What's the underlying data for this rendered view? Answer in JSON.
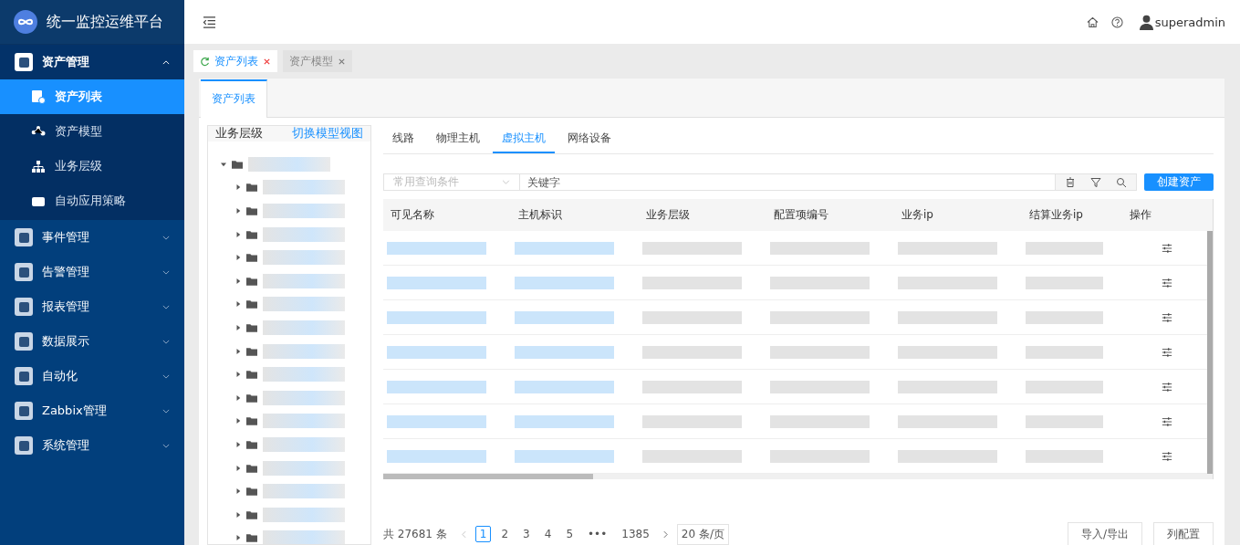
{
  "app": {
    "title": "统一监控运维平台"
  },
  "header": {
    "user": "superadmin"
  },
  "menu": [
    {
      "label": "资产管理",
      "expanded": true,
      "children": [
        {
          "label": "资产列表",
          "selected": true
        },
        {
          "label": "资产模型",
          "selected": false
        },
        {
          "label": "业务层级",
          "selected": false
        },
        {
          "label": "自动应用策略",
          "selected": false
        }
      ]
    },
    {
      "label": "事件管理",
      "expanded": false
    },
    {
      "label": "告警管理",
      "expanded": false
    },
    {
      "label": "报表管理",
      "expanded": false
    },
    {
      "label": "数据展示",
      "expanded": false
    },
    {
      "label": "自动化",
      "expanded": false
    },
    {
      "label": "Zabbix管理",
      "expanded": false
    },
    {
      "label": "系统管理",
      "expanded": false
    }
  ],
  "page_tabs": [
    {
      "label": "资产列表",
      "selected": true
    },
    {
      "label": "资产模型",
      "selected": false
    }
  ],
  "inner_tabs": [
    {
      "label": "资产列表",
      "selected": true
    }
  ],
  "tree_panel": {
    "title": "业务层级",
    "link": "切换模型视图",
    "root": {
      "expanded": true,
      "children": [
        {
          "expanded": false
        },
        {
          "expanded": false
        },
        {
          "expanded": false
        },
        {
          "expanded": false
        },
        {
          "expanded": false
        },
        {
          "expanded": false
        },
        {
          "expanded": false
        },
        {
          "expanded": false
        },
        {
          "expanded": false
        },
        {
          "expanded": false
        },
        {
          "expanded": false
        },
        {
          "expanded": false
        },
        {
          "expanded": false
        },
        {
          "expanded": false
        },
        {
          "expanded": false
        },
        {
          "expanded": false
        }
      ]
    }
  },
  "category_tabs": [
    {
      "label": "线路",
      "selected": false
    },
    {
      "label": "物理主机",
      "selected": false
    },
    {
      "label": "虚拟主机",
      "selected": true
    },
    {
      "label": "网络设备",
      "selected": false
    }
  ],
  "search": {
    "condition_placeholder": "常用查询条件",
    "placeholder": "关键字",
    "create_button": "创建资产"
  },
  "table": {
    "columns": [
      "可见名称",
      "主机标识",
      "业务层级",
      "配置项编号",
      "业务ip",
      "结算业务ip",
      "操作"
    ],
    "rows": [
      {
        "redacted": true
      },
      {
        "redacted": true
      },
      {
        "redacted": true
      },
      {
        "redacted": true
      },
      {
        "redacted": true
      },
      {
        "redacted": true
      },
      {
        "redacted": true
      }
    ]
  },
  "pagination": {
    "total": "共 27681 条",
    "pages": [
      {
        "label": "1",
        "selected": true
      },
      {
        "label": "2",
        "selected": false
      },
      {
        "label": "3",
        "selected": false
      },
      {
        "label": "4",
        "selected": false
      },
      {
        "label": "5",
        "selected": false
      },
      {
        "label": "•••",
        "selected": false
      },
      {
        "label": "1385",
        "selected": false
      }
    ],
    "page_size": "20 条/页"
  },
  "footer_buttons": [
    "导入/导出",
    "列配置"
  ]
}
